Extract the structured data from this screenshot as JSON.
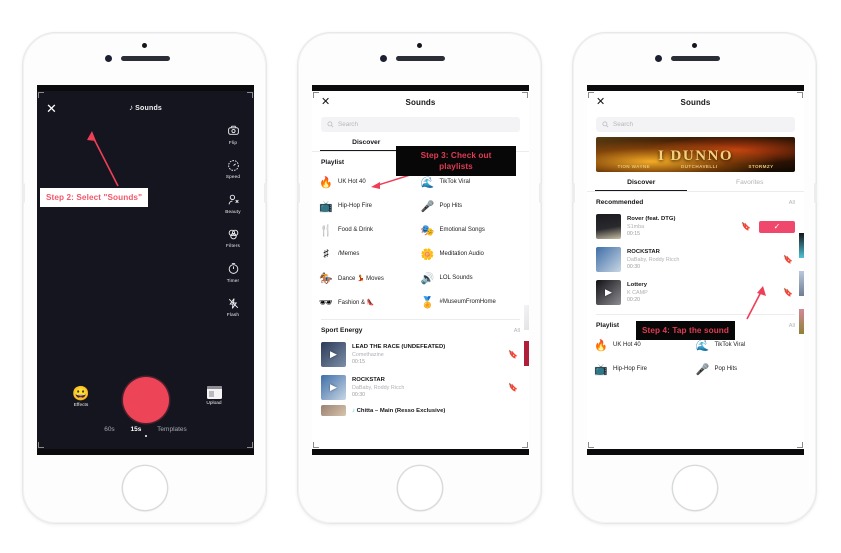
{
  "meta": {
    "accent_red": "#ee4458",
    "accent_pink": "#f0486c",
    "camera_bg": "#14151f",
    "annotation_text_red": "#e23b53"
  },
  "annotations": [
    {
      "id": "step2",
      "text": "Step 2: Select \"Sounds\"",
      "style": "light"
    },
    {
      "id": "step3",
      "text": "Step 3: Check out playlists",
      "line1": "Step 3: Check out",
      "line2": "playlists",
      "style": "dark"
    },
    {
      "id": "step4",
      "text": "Step 4: Tap the sound",
      "style": "dark"
    }
  ],
  "phone1": {
    "screen_name": "tiktok-camera",
    "close_label": "✕",
    "sounds_label": "Sounds",
    "sounds_icon": "music-note-icon",
    "right_rail": [
      {
        "label": "Flip",
        "icon": "flip-camera-icon"
      },
      {
        "label": "Speed",
        "icon": "speed-icon"
      },
      {
        "label": "Beauty",
        "icon": "beauty-icon"
      },
      {
        "label": "Filters",
        "icon": "filters-icon"
      },
      {
        "label": "Timer",
        "icon": "timer-icon"
      },
      {
        "label": "Flash",
        "icon": "flash-off-icon"
      }
    ],
    "effects_label": "Effects",
    "effects_icon": "smiley-effects-icon",
    "upload_label": "Upload",
    "upload_icon": "upload-media-icon",
    "record_button": "record-button",
    "modes": [
      {
        "label": "60s",
        "active": false
      },
      {
        "label": "15s",
        "active": true
      },
      {
        "label": "Templates",
        "active": false
      }
    ]
  },
  "phone2": {
    "screen_name": "sounds-discover",
    "close_label": "✕",
    "title": "Sounds",
    "search_placeholder": "Search",
    "search_icon": "search-icon",
    "tabs": [
      {
        "label": "Discover",
        "active": true
      }
    ],
    "playlist_section": {
      "title": "Playlist"
    },
    "playlists": [
      {
        "label": "UK Hot 40",
        "icon": "flame-icon",
        "color": "#e8435f"
      },
      {
        "label": "TikTok Viral",
        "icon": "cloud-music-icon",
        "color": "#f0a93a"
      },
      {
        "label": "Hip-Hop Fire",
        "icon": "boombox-icon",
        "color": "#e8a84a"
      },
      {
        "label": "Pop Hits",
        "icon": "microphone-icon",
        "color": "#ec5a7e"
      },
      {
        "label": "Food & Drink",
        "icon": "cutlery-icon",
        "color": "#5bc8d8"
      },
      {
        "label": "Emotional Songs",
        "icon": "theatre-masks-icon",
        "color": "#8a5ad8"
      },
      {
        "label": "/Memes",
        "icon": "hashtag-box-icon",
        "color": "#8a5ad8"
      },
      {
        "label": "Meditation Audio",
        "icon": "lotus-icon",
        "color": "#7fc98a"
      },
      {
        "label": "Dance 💃 Moves",
        "icon": "dancer-icon",
        "color": "#9a5ad8"
      },
      {
        "label": "LOL Sounds",
        "icon": "speaker-icon",
        "color": "#e8558a"
      },
      {
        "label": "Fashion & 👠",
        "icon": "sunglasses-icon",
        "color": "#9a5ad8"
      },
      {
        "label": "#MuseumFromHome",
        "icon": "medal-icon",
        "color": "#e8a84a"
      }
    ],
    "sport_section": {
      "title": "Sport Energy",
      "all_label": "All"
    },
    "songs": [
      {
        "title": "LEAD THE RACE (UNDEFEATED)",
        "artist": "Comethazine",
        "duration": "00:15",
        "thumb_a": "#2b3a58",
        "thumb_b": "#7d8fa8",
        "bookmark": true
      },
      {
        "title": "ROCKSTAR",
        "artist": "DaBaby, Roddy Ricch",
        "duration": "00:30",
        "thumb_a": "#3e6ea8",
        "thumb_b": "#c9d6e4",
        "bookmark": true
      }
    ],
    "footer_song": {
      "title": "Chitta – Main (Resso Exclusive)",
      "icon": "music-note-icon",
      "thumb_a": "#9a8170",
      "thumb_b": "#d8c4ae"
    }
  },
  "phone3": {
    "screen_name": "sounds-discover-selected",
    "close_label": "✕",
    "title": "Sounds",
    "search_placeholder": "Search",
    "search_icon": "search-icon",
    "banner": {
      "title": "I DUNNO",
      "artists": [
        "TION WAYNE",
        "DUTCHAVELLI",
        "STORMZY"
      ]
    },
    "tabs": [
      {
        "label": "Discover",
        "active": true
      },
      {
        "label": "Favorites",
        "active": false
      }
    ],
    "recommended_section": {
      "title": "Recommended",
      "all_label": "All"
    },
    "songs": [
      {
        "title": "Rover (feat. DTG)",
        "artist": "S1mba",
        "duration": "00:15",
        "selected": true,
        "check_label": "✓",
        "thumb_a": "#1b1b1f",
        "thumb_b": "#c9bda4",
        "bookmark": true
      },
      {
        "title": "ROCKSTAR",
        "artist": "DaBaby, Roddy Ricch",
        "duration": "00:30",
        "selected": false,
        "thumb_a": "#3e6ea8",
        "thumb_b": "#c9d6e4",
        "bookmark": true
      },
      {
        "title": "Lottery",
        "artist": "K CAMP",
        "duration": "00:20",
        "selected": false,
        "thumb_a": "#101014",
        "thumb_b": "#8d8d93",
        "bookmark": true
      }
    ],
    "playlist_section": {
      "title": "Playlist",
      "all_label": "All"
    },
    "playlists": [
      {
        "label": "UK Hot 40",
        "icon": "flame-icon",
        "color": "#e8435f"
      },
      {
        "label": "TikTok Viral",
        "icon": "cloud-music-icon",
        "color": "#f0a93a"
      },
      {
        "label": "Hip-Hop Fire",
        "icon": "boombox-icon",
        "color": "#e8a84a"
      },
      {
        "label": "Pop Hits",
        "icon": "microphone-icon",
        "color": "#ec5a7e"
      }
    ]
  }
}
